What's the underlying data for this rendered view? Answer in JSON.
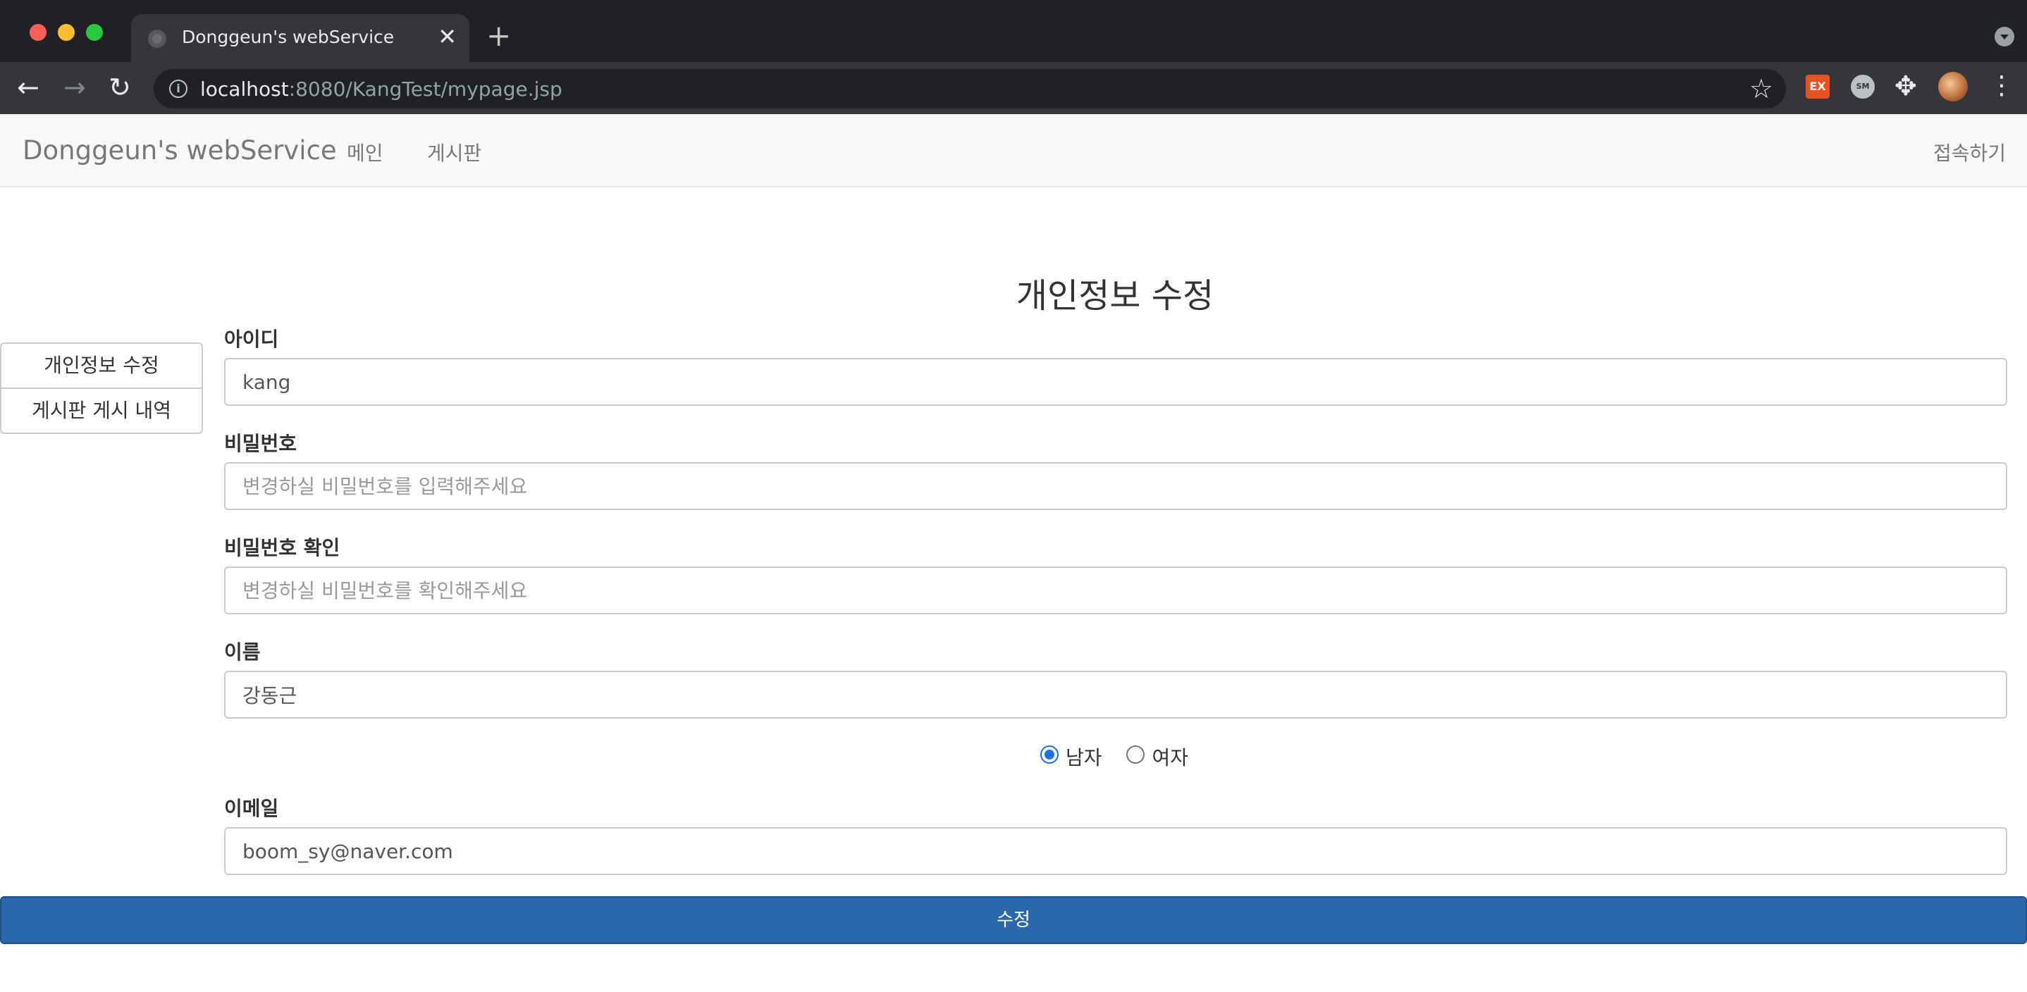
{
  "browser": {
    "tab_title": "Donggeun's webService",
    "tab_close": "✕",
    "new_tab": "+",
    "url_host": "localhost",
    "url_rest": ":8080/KangTest/mypage.jsp",
    "ext_ex_label": "EX",
    "ext_sm_label": "SM"
  },
  "navbar": {
    "brand": "Donggeun's webService",
    "links": [
      "메인",
      "게시판"
    ],
    "right_link": "접속하기"
  },
  "page": {
    "title": "개인정보 수정"
  },
  "side_menu": {
    "items": [
      "개인정보 수정",
      "게시판 게시 내역"
    ]
  },
  "form": {
    "id_label": "아이디",
    "id_value": "kang",
    "password_label": "비밀번호",
    "password_placeholder": "변경하실 비밀번호를 입력해주세요",
    "password_confirm_label": "비밀번호 확인",
    "password_confirm_placeholder": "변경하실 비밀번호를 확인해주세요",
    "name_label": "이름",
    "name_value": "강동근",
    "gender_options": [
      "남자",
      "여자"
    ],
    "gender_selected": "남자",
    "email_label": "이메일",
    "email_value": "boom_sy@naver.com",
    "submit_label": "수정"
  },
  "colors": {
    "submit_bg": "#2a67ab",
    "navbar_bg": "#f8f8f8",
    "radio_accent": "#1a73e8"
  }
}
